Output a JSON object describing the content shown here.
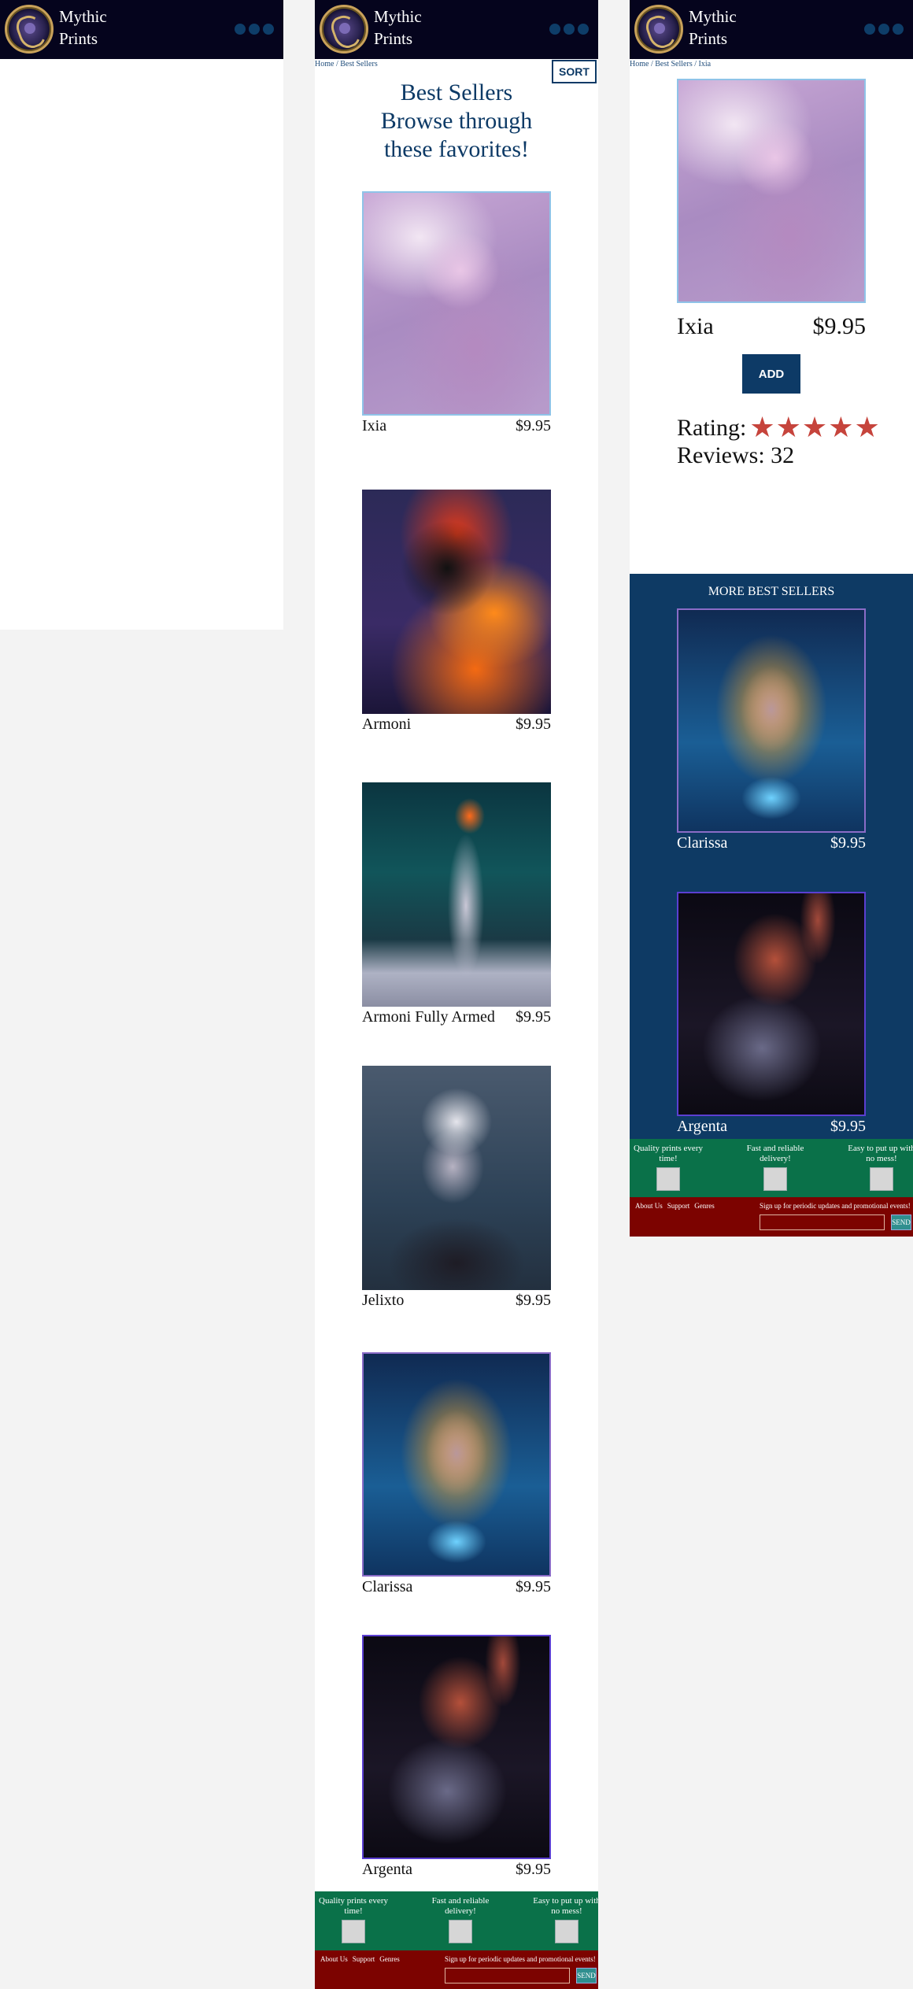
{
  "brand": {
    "name_line1": "Mythic",
    "name_line2": "Prints"
  },
  "list_page": {
    "breadcrumb": "Home / Best Sellers",
    "sort_label": "SORT",
    "title_line1": "Best Sellers",
    "title_line2": "Browse through",
    "title_line3": "these favorites!",
    "products": [
      {
        "name": "Ixia",
        "price": "$9.95",
        "art": "ixia"
      },
      {
        "name": "Armoni",
        "price": "$9.95",
        "art": "armoni"
      },
      {
        "name": "Armoni Fully Armed",
        "price": "$9.95",
        "art": "armoni-full"
      },
      {
        "name": "Jelixto",
        "price": "$9.95",
        "art": "jelixto"
      },
      {
        "name": "Clarissa",
        "price": "$9.95",
        "art": "clarissa"
      },
      {
        "name": "Argenta",
        "price": "$9.95",
        "art": "argenta"
      }
    ]
  },
  "detail_page": {
    "breadcrumb": "Home / Best Sellers / Ixia",
    "name": "Ixia",
    "price": "$9.95",
    "add_label": "ADD",
    "rating_label": "Rating:",
    "rating_value": 5,
    "rating_max": 5,
    "reviews_label": "Reviews: 32",
    "more_title": "MORE BEST SELLERS",
    "more": [
      {
        "name": "Clarissa",
        "price": "$9.95"
      },
      {
        "name": "Argenta",
        "price": "$9.95"
      }
    ]
  },
  "footer": {
    "features": [
      "Quality prints every time!",
      "Fast and reliable delivery!",
      "Easy to put up with no mess!"
    ],
    "links": [
      "About Us",
      "Support",
      "Genres"
    ],
    "newsletter": "Sign up for periodic updates and promotional events!",
    "send_label": "SEND"
  },
  "colors": {
    "header": "#05041d",
    "accent": "#0d3a66",
    "footer_green": "#0a7149",
    "footer_red": "#7c0300",
    "star": "#c6443c"
  }
}
